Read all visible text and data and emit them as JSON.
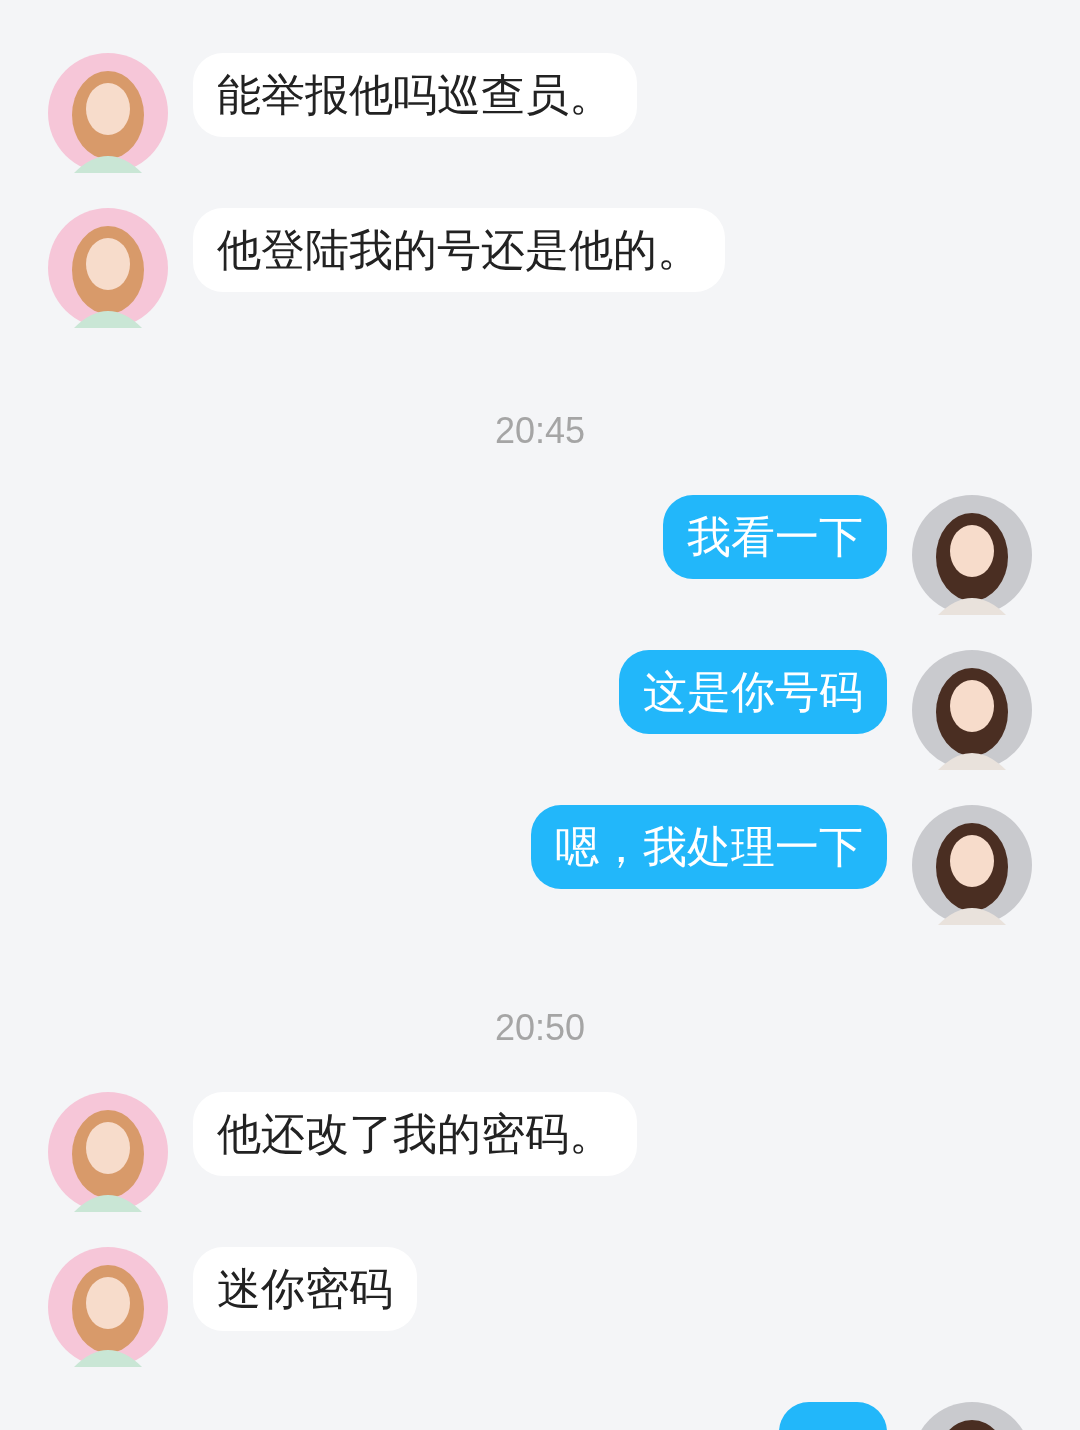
{
  "messages": [
    {
      "kind": "incoming",
      "text": "能举报他吗巡查员。"
    },
    {
      "kind": "incoming",
      "text": "他登陆我的号还是他的。"
    },
    {
      "kind": "time",
      "text": "20:45"
    },
    {
      "kind": "outgoing",
      "text": "我看一下"
    },
    {
      "kind": "outgoing",
      "text": "这是你号码"
    },
    {
      "kind": "outgoing",
      "text": "嗯，我处理一下"
    },
    {
      "kind": "time",
      "text": "20:50"
    },
    {
      "kind": "incoming",
      "text": "他还改了我的密码。"
    },
    {
      "kind": "incoming",
      "text": "迷你密码"
    },
    {
      "kind": "outgoing"
    }
  ]
}
